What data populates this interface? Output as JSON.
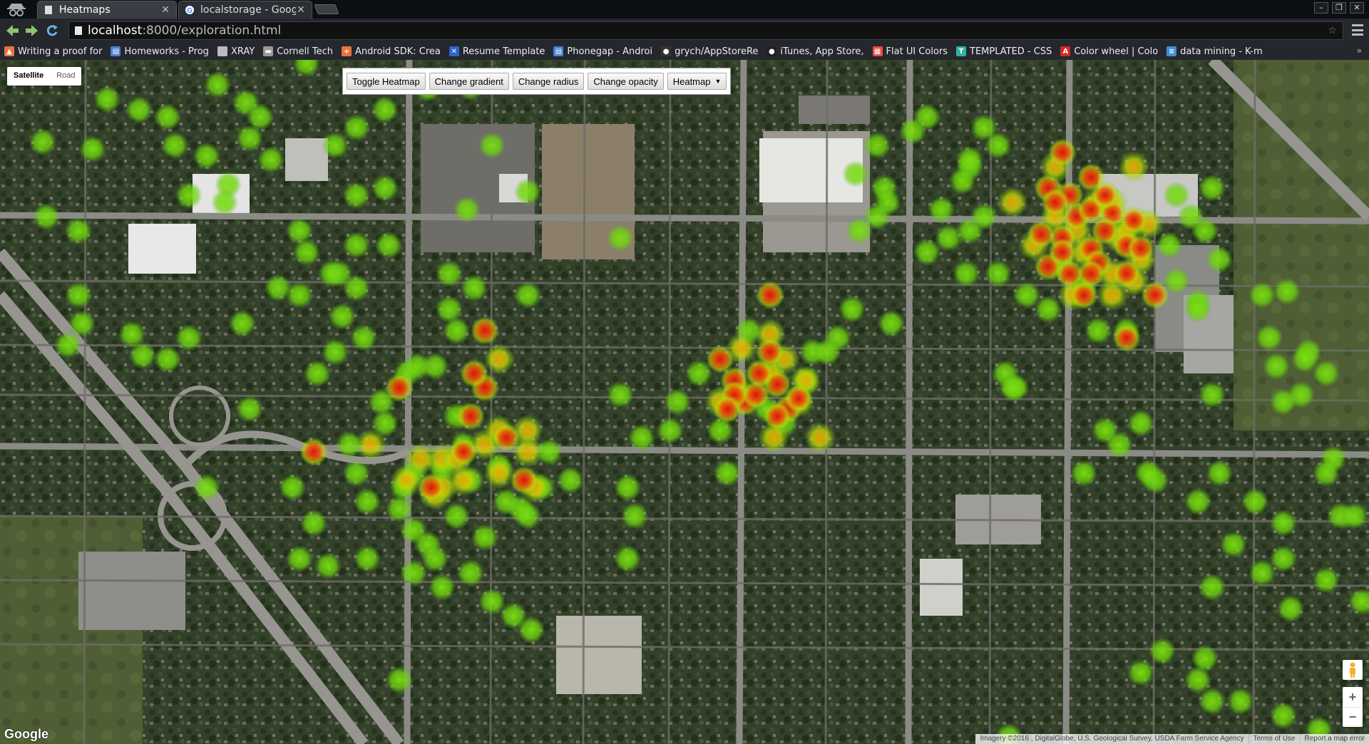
{
  "browser": {
    "tabs": [
      {
        "title": "Heatmaps",
        "active": true
      },
      {
        "title": "localstorage - Google",
        "active": false
      }
    ],
    "url_host": "localhost",
    "url_path": ":8000/exploration.html",
    "bookmarks": [
      {
        "label": "Writing a proof for",
        "icon": "flame-icon",
        "color": "#e8743b"
      },
      {
        "label": "Homeworks - Prog",
        "icon": "doc-icon",
        "color": "#4a7fd4"
      },
      {
        "label": "XRAY",
        "icon": "page-icon",
        "color": "#bbbbbb"
      },
      {
        "label": "Cornell Tech",
        "icon": "folder-icon",
        "color": "#999999"
      },
      {
        "label": "Android SDK: Crea",
        "icon": "plus-icon",
        "color": "#e8743b"
      },
      {
        "label": "Resume Template",
        "icon": "x-icon",
        "color": "#2b65c9"
      },
      {
        "label": "Phonegap - Androi",
        "icon": "doc-icon",
        "color": "#4a7fd4"
      },
      {
        "label": "grych/AppStoreRe",
        "icon": "github-icon",
        "color": "#333333"
      },
      {
        "label": "iTunes, App Store,",
        "icon": "apple-icon",
        "color": "#222222"
      },
      {
        "label": "Flat UI Colors",
        "icon": "grid-icon",
        "color": "#e74c3c"
      },
      {
        "label": "TEMPLATED - CSS",
        "icon": "t-icon",
        "color": "#2bb3a3"
      },
      {
        "label": "Color wheel | Colo",
        "icon": "a-icon",
        "color": "#d62828"
      },
      {
        "label": "data mining - K-m",
        "icon": "stack-icon",
        "color": "#3f8fd8"
      }
    ]
  },
  "map": {
    "type_control": {
      "satellite": "Satellite",
      "road": "Road"
    },
    "panel": {
      "toggle_heatmap": "Toggle Heatmap",
      "change_gradient": "Change gradient",
      "change_radius": "Change radius",
      "change_opacity": "Change opacity",
      "select_value": "Heatmap"
    },
    "zoom_in": "+",
    "zoom_out": "−",
    "google_logo": "Google",
    "attribution": "Imagery ©2016 , DigitalGlobe, U.S. Geological Survey, USDA Farm Service Agency",
    "terms": "Terms of Use",
    "report": "Report a map error",
    "colors": {
      "hot": "#d9140f",
      "warm": "#f0a000",
      "cool": "#7cdc14"
    }
  }
}
